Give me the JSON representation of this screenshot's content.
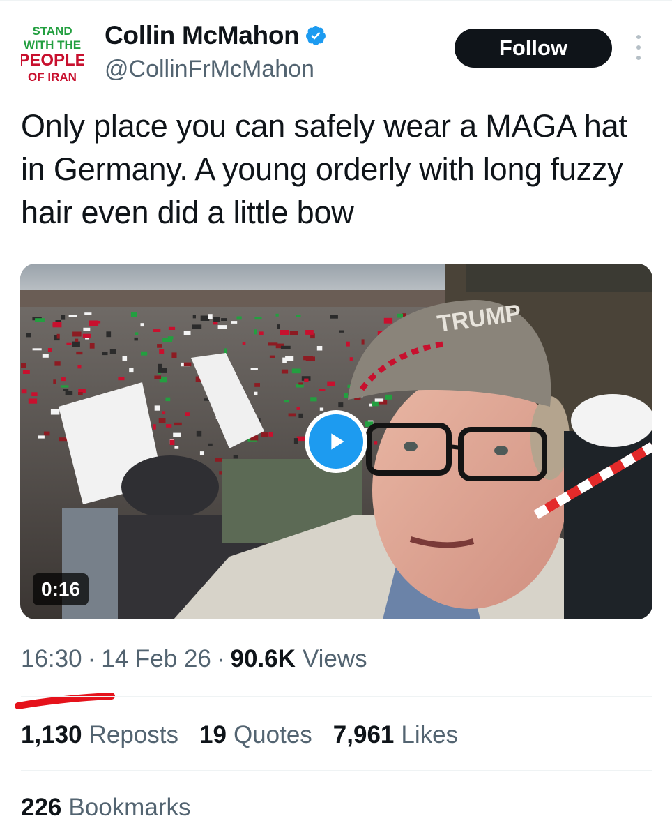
{
  "author": {
    "avatar_text": [
      "STAND",
      "WITH THE",
      "PEOPLE",
      "OF IRAN"
    ],
    "display_name": "Collin McMahon",
    "handle": "@CollinFrMcMahon",
    "verified": true,
    "verified_icon": "verified-badge-icon"
  },
  "follow_label": "Follow",
  "tweet": {
    "text": "Only place you can safely wear a MAGA hat in Germany. A young orderly with long fuzzy hair even did a little bow"
  },
  "media": {
    "type": "video",
    "duration": "0:16",
    "play_icon": "play-icon",
    "hat_text": "TRUMP"
  },
  "meta": {
    "time": "16:30",
    "date": "14 Feb 26",
    "views_count": "90.6K",
    "views_label": "Views",
    "separator": "·"
  },
  "stats": {
    "reposts": {
      "count": "1,130",
      "label": "Reposts"
    },
    "quotes": {
      "count": "19",
      "label": "Quotes"
    },
    "likes": {
      "count": "7,961",
      "label": "Likes"
    }
  },
  "bookmarks": {
    "count": "226",
    "label": "Bookmarks"
  },
  "colors": {
    "text": "#0f1419",
    "secondary": "#536471",
    "accent": "#1d9bf0",
    "divider": "#eff3f4",
    "annotation_red": "#e5121b",
    "avatar_red": "#c8102e",
    "avatar_green": "#239f40"
  }
}
